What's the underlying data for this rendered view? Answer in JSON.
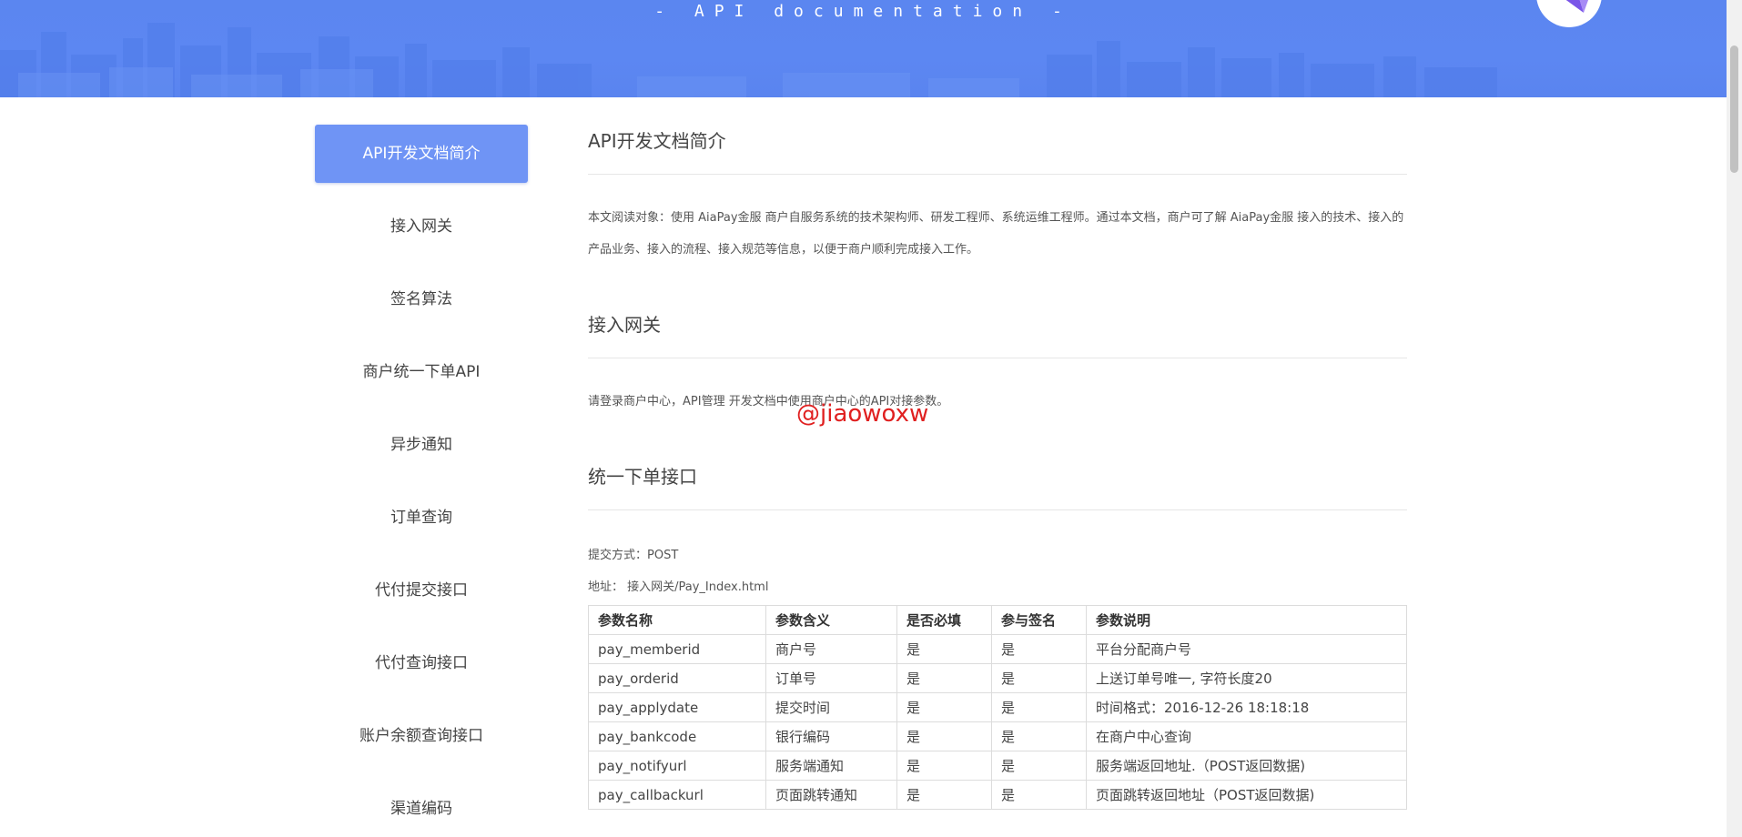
{
  "banner": {
    "title": "- API documentation -"
  },
  "colors": {
    "banner": "#5b86f0",
    "nav_active": "#6f94f5",
    "watermark": "#e02020"
  },
  "sidebar": {
    "items": [
      {
        "label": "API开发文档简介",
        "active": true
      },
      {
        "label": "接入网关",
        "active": false
      },
      {
        "label": "签名算法",
        "active": false
      },
      {
        "label": "商户统一下单API",
        "active": false
      },
      {
        "label": "异步通知",
        "active": false
      },
      {
        "label": "订单查询",
        "active": false
      },
      {
        "label": "代付提交接口",
        "active": false
      },
      {
        "label": "代付查询接口",
        "active": false
      },
      {
        "label": "账户余额查询接口",
        "active": false
      },
      {
        "label": "渠道编码",
        "active": false
      }
    ]
  },
  "main": {
    "intro": {
      "title": "API开发文档简介",
      "text": "本文阅读对象：使用 AiaPay金服 商户自服务系统的技术架构师、研发工程师、系统运维工程师。通过本文档，商户可了解 AiaPay金服 接入的技术、接入的产品业务、接入的流程、接入规范等信息，以便于商户顺利完成接入工作。"
    },
    "gateway": {
      "title": "接入网关",
      "text": "请登录商户中心，API管理 开发文档中使用商户中心的API对接参数。"
    },
    "order": {
      "title": "统一下单接口",
      "method": "提交方式：POST",
      "address": "地址：  接入网关/Pay_Index.html",
      "table": {
        "headers": [
          "参数名称",
          "参数含义",
          "是否必填",
          "参与签名",
          "参数说明"
        ],
        "rows": [
          [
            "pay_memberid",
            "商户号",
            "是",
            "是",
            "平台分配商户号"
          ],
          [
            "pay_orderid",
            "订单号",
            "是",
            "是",
            "上送订单号唯一, 字符长度20"
          ],
          [
            "pay_applydate",
            "提交时间",
            "是",
            "是",
            "时间格式：2016-12-26 18:18:18"
          ],
          [
            "pay_bankcode",
            "银行编码",
            "是",
            "是",
            "在商户中心查询"
          ],
          [
            "pay_notifyurl",
            "服务端通知",
            "是",
            "是",
            "服务端返回地址.（POST返回数据)"
          ],
          [
            "pay_callbackurl",
            "页面跳转通知",
            "是",
            "是",
            "页面跳转返回地址（POST返回数据)"
          ]
        ]
      }
    }
  },
  "watermark": "@jiaowoxw"
}
